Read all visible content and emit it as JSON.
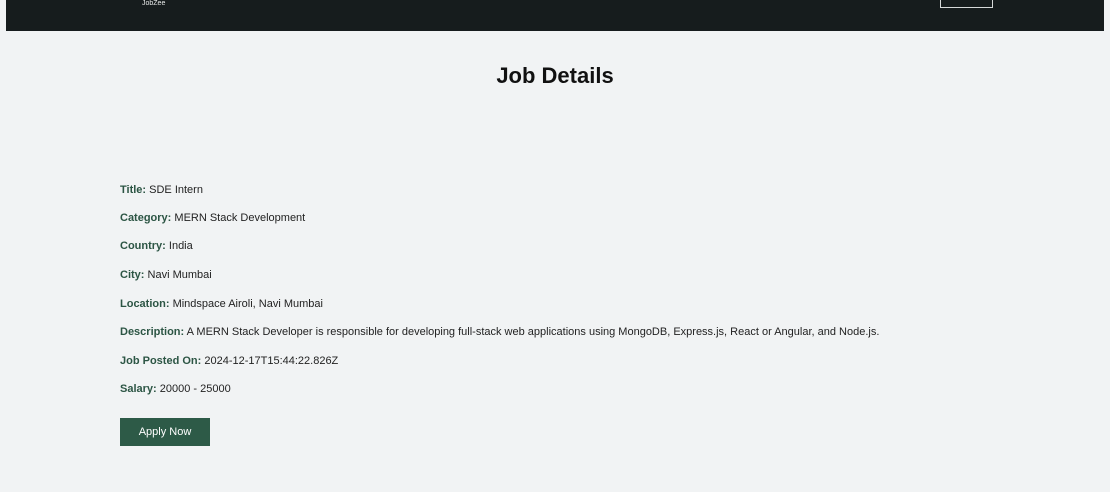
{
  "navbar": {
    "brand": "JobZee"
  },
  "page": {
    "title": "Job Details"
  },
  "details": [
    {
      "label": "Title:",
      "value": "SDE Intern"
    },
    {
      "label": "Category:",
      "value": "MERN Stack Development"
    },
    {
      "label": "Country:",
      "value": "India"
    },
    {
      "label": "City:",
      "value": "Navi Mumbai"
    },
    {
      "label": "Location:",
      "value": "Mindspace Airoli, Navi Mumbai"
    },
    {
      "label": "Description:",
      "value": "A MERN Stack Developer is responsible for developing full-stack web applications using MongoDB, Express.js, React or Angular, and Node.js."
    },
    {
      "label": "Job Posted On:",
      "value": "2024-12-17T15:44:22.826Z"
    },
    {
      "label": "Salary:",
      "value": "20000 - 25000"
    }
  ],
  "actions": {
    "apply_label": "Apply Now"
  }
}
